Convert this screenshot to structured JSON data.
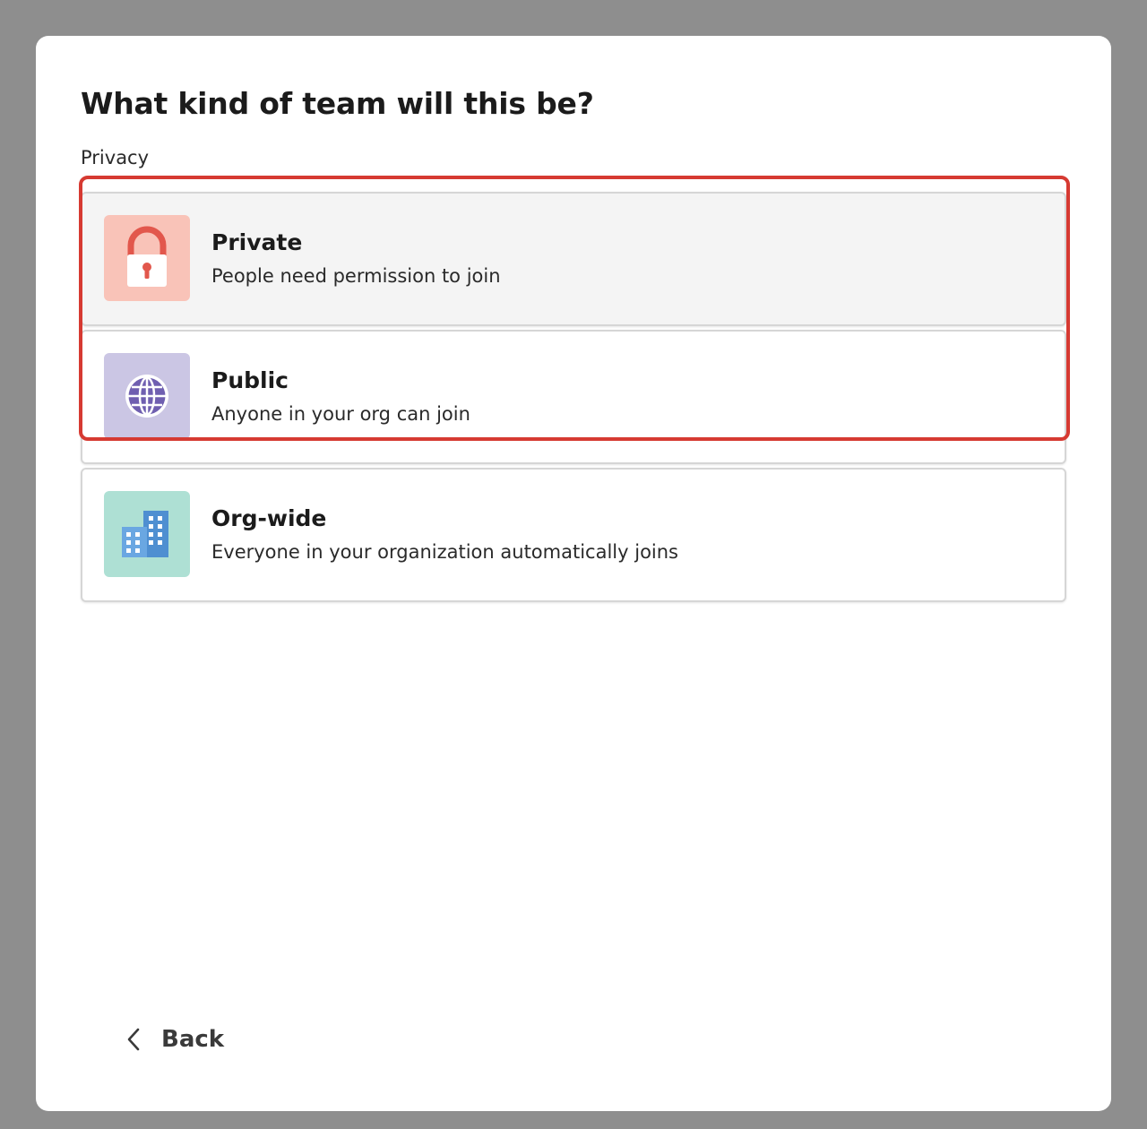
{
  "dialog": {
    "title": "What kind of team will this be?",
    "section_label": "Privacy"
  },
  "options": [
    {
      "title": "Private",
      "description": "People need permission to join",
      "icon": "lock-icon",
      "tile_color": "#f9c3b8",
      "hovered": true
    },
    {
      "title": "Public",
      "description": "Anyone in your org can join",
      "icon": "globe-icon",
      "tile_color": "#cbc6e4"
    },
    {
      "title": "Org-wide",
      "description": "Everyone in your organization automatically joins",
      "icon": "building-icon",
      "tile_color": "#aee0d4"
    }
  ],
  "highlight_color": "#d63a32",
  "footer": {
    "back_label": "Back",
    "back_icon": "chevron-left-icon"
  }
}
